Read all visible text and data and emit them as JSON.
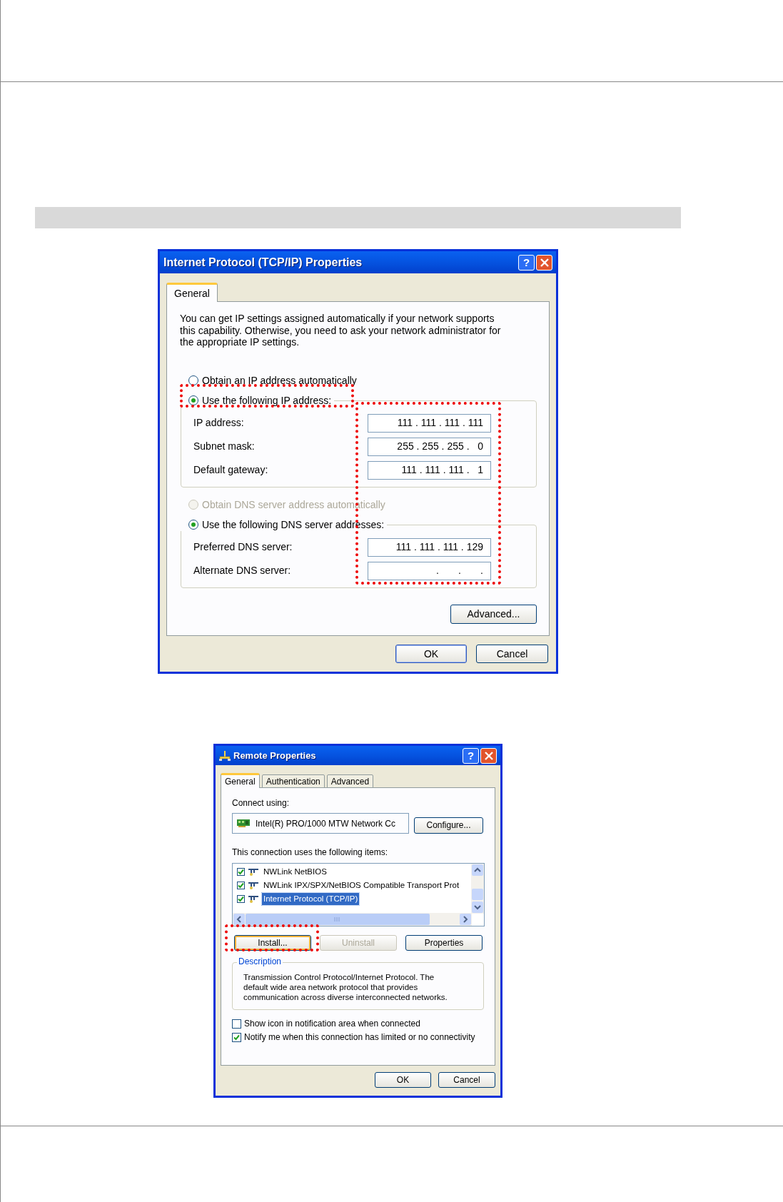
{
  "tcpip_dialog": {
    "title": "Internet Protocol (TCP/IP) Properties",
    "help_button": "?",
    "tabs": [
      {
        "label": "General",
        "selected": true
      }
    ],
    "intro": "You can get IP settings assigned automatically if your network supports this capability. Otherwise, you need to ask your network administrator for the appropriate IP settings.",
    "ip_mode": [
      {
        "label": "Obtain an IP address automatically",
        "selected": false,
        "disabled": false
      },
      {
        "label": "Use the following IP address:",
        "selected": true,
        "disabled": false
      }
    ],
    "ip_fields": [
      {
        "label": "IP address:",
        "value": "111 . 111 . 111 . 111"
      },
      {
        "label": "Subnet mask:",
        "value": "255 . 255 . 255 .   0"
      },
      {
        "label": "Default gateway:",
        "value": "111 . 111 . 111 .   1"
      }
    ],
    "dns_mode": [
      {
        "label": "Obtain DNS server address automatically",
        "selected": false,
        "disabled": true
      },
      {
        "label": "Use the following DNS server addresses:",
        "selected": true,
        "disabled": false
      }
    ],
    "dns_fields": [
      {
        "label": "Preferred DNS server:",
        "value": "111 . 111 . 111 . 129"
      },
      {
        "label": "Alternate DNS server:",
        "value": ".       .       ."
      }
    ],
    "advanced_button": "Advanced...",
    "ok_button": "OK",
    "cancel_button": "Cancel"
  },
  "remote_dialog": {
    "title": "Remote Properties",
    "help_button": "?",
    "tabs": [
      {
        "label": "General",
        "selected": true
      },
      {
        "label": "Authentication",
        "selected": false
      },
      {
        "label": "Advanced",
        "selected": false
      }
    ],
    "connect_label": "Connect using:",
    "adapter": "Intel(R) PRO/1000 MTW Network Cc",
    "configure_button": "Configure...",
    "items_label": "This connection uses the following items:",
    "items": [
      {
        "label": "NWLink NetBIOS",
        "checked": true,
        "selected": false
      },
      {
        "label": "NWLink IPX/SPX/NetBIOS Compatible Transport Prot",
        "checked": true,
        "selected": false
      },
      {
        "label": "Internet Protocol (TCP/IP)",
        "checked": true,
        "selected": true
      }
    ],
    "item_buttons": [
      {
        "label": "Install...",
        "disabled": false
      },
      {
        "label": "Uninstall",
        "disabled": true
      },
      {
        "label": "Properties",
        "disabled": false
      }
    ],
    "description": {
      "legend": "Description",
      "text": "Transmission Control Protocol/Internet Protocol. The default wide area network protocol that provides communication across diverse interconnected networks."
    },
    "options": [
      {
        "label": "Show icon in notification area when connected",
        "checked": false
      },
      {
        "label": "Notify me when this connection has limited or no connectivity",
        "checked": true
      }
    ],
    "ok_button": "OK",
    "cancel_button": "Cancel"
  }
}
